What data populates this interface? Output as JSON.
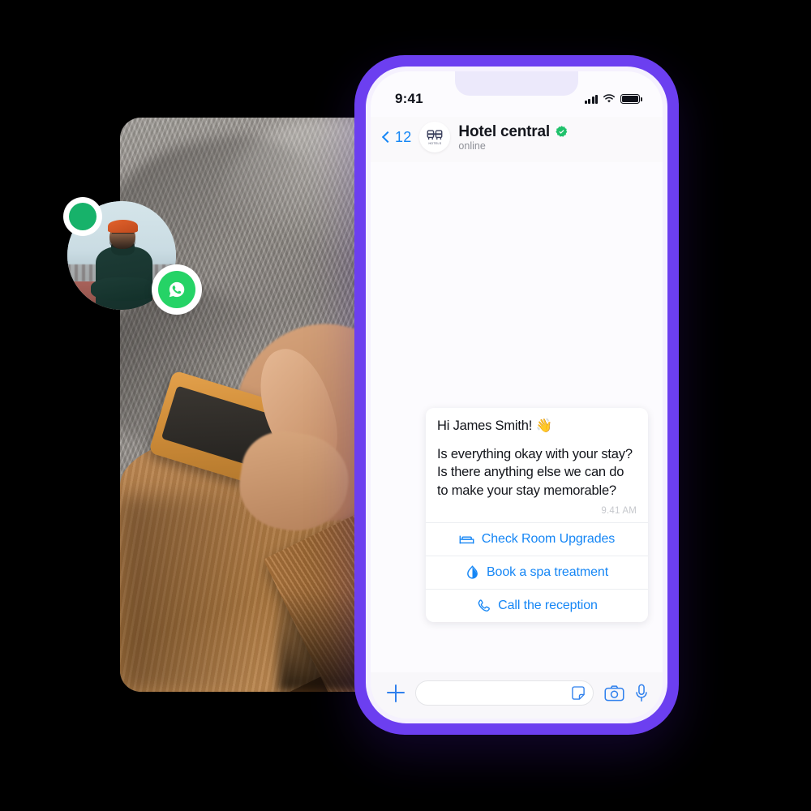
{
  "scene": {
    "colors": {
      "phone_bezel": "#6c3ff0",
      "accent_blue": "#1586f5",
      "whatsapp_green": "#25d366",
      "online_green": "#17b26a"
    }
  },
  "avatar": {
    "name": "contact-avatar",
    "online": true,
    "channel": "whatsapp"
  },
  "phone": {
    "status_bar": {
      "time": "9:41",
      "icons": [
        "cellular-signal-icon",
        "wifi-icon",
        "battery-icon"
      ]
    },
    "chat_header": {
      "back_count": "12",
      "brand_logo_caption": "HOTELS",
      "title": "Hotel central",
      "verified": true,
      "status": "online"
    },
    "message": {
      "greeting": "Hi James Smith! 👋",
      "body": "Is everything okay with your stay? Is there anything else we can do to make your stay memorable?",
      "time": "9.41 AM",
      "quick_replies": [
        {
          "icon": "bed-icon",
          "label": "Check Room Upgrades"
        },
        {
          "icon": "spa-droplet-icon",
          "label": "Book a spa treatment"
        },
        {
          "icon": "phone-call-icon",
          "label": "Call the reception"
        }
      ]
    },
    "input_bar": {
      "placeholder": "",
      "value": "",
      "icons": [
        "plus-icon",
        "sticker-icon",
        "camera-icon",
        "microphone-icon"
      ]
    }
  }
}
